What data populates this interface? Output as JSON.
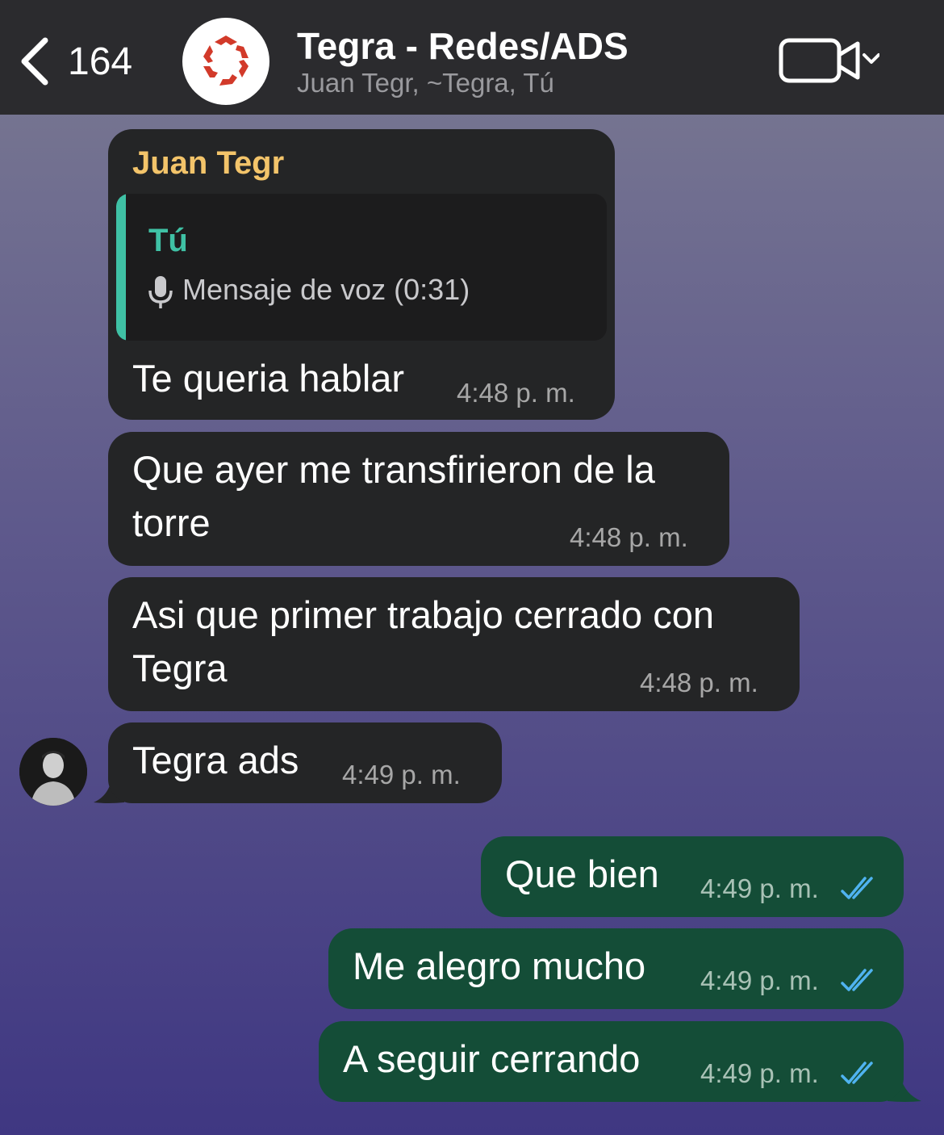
{
  "header": {
    "back_count": "164",
    "title": "Tegra - Redes/ADS",
    "subtitle": "Juan Tegr, ~Tegra, Tú",
    "back_icon": "chevron-left-icon",
    "video_icon": "video-camera-icon"
  },
  "messages": {
    "m1": {
      "sender": "Juan Tegr",
      "quote_name": "Tú",
      "quote_text": "Mensaje de voz (0:31)",
      "text": "Te queria hablar",
      "time": "4:48",
      "ampm": "p. m."
    },
    "m2": {
      "line1": "Que ayer me transfirieron de la",
      "line2": "torre",
      "time": "4:48",
      "ampm": "p. m."
    },
    "m3": {
      "line1": "Asi que primer trabajo cerrado con",
      "line2": "Tegra",
      "time": "4:48",
      "ampm": "p. m."
    },
    "m4": {
      "text": "Tegra ads",
      "time": "4:49",
      "ampm": "p. m."
    },
    "m5": {
      "text": "Que bien",
      "time": "4:49",
      "ampm": "p. m."
    },
    "m6": {
      "text": "Me alegro mucho",
      "time": "4:49",
      "ampm": "p. m."
    },
    "m7": {
      "text": "A seguir cerrando",
      "time": "4:49",
      "ampm": "p. m."
    }
  },
  "colors": {
    "incoming_bubble": "#242526",
    "outgoing_bubble": "#144d37",
    "sender_name": "#f3c46a",
    "quote_accent": "#3fc1a5",
    "read_ticks": "#4fb3f0"
  }
}
